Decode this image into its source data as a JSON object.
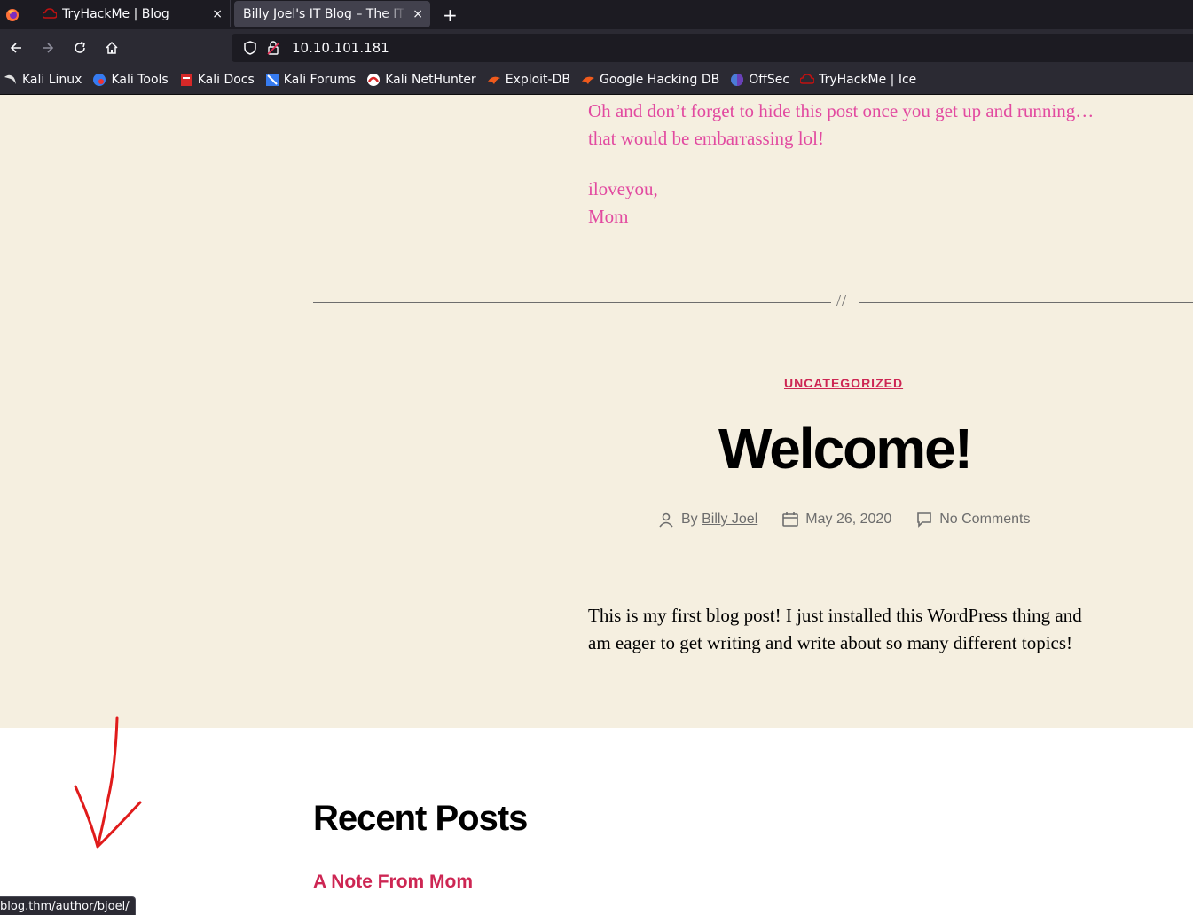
{
  "browser": {
    "tabs": [
      {
        "title": "TryHackMe | Blog",
        "close": "×"
      },
      {
        "title": "Billy Joel's IT Blog – The IT blog",
        "close": "×"
      }
    ],
    "new_tab": "+",
    "url": "10.10.101.181",
    "bookmarks": [
      {
        "label": "Kali Linux",
        "icon": "kali-dragon-icon"
      },
      {
        "label": "Kali Tools",
        "icon": "kali-tools-icon"
      },
      {
        "label": "Kali Docs",
        "icon": "kali-docs-icon"
      },
      {
        "label": "Kali Forums",
        "icon": "kali-forums-icon"
      },
      {
        "label": "Kali NetHunter",
        "icon": "nethunter-icon"
      },
      {
        "label": "Exploit-DB",
        "icon": "exploit-db-icon"
      },
      {
        "label": "Google Hacking DB",
        "icon": "ghdb-icon"
      },
      {
        "label": "OffSec",
        "icon": "offsec-icon"
      },
      {
        "label": "TryHackMe | Ice",
        "icon": "tryhackme-icon"
      }
    ],
    "status_url": "blog.thm/author/bjoel/"
  },
  "previous_post": {
    "paragraph": "Oh and don’t forget to hide this post once you get up and running… that would be embarrassing lol!",
    "signoff_1": "iloveyou,",
    "signoff_2": "Mom"
  },
  "separator_mark": "//",
  "post": {
    "category": "UNCATEGORIZED",
    "title": "Welcome!",
    "author_prefix": "By",
    "author": "Billy Joel",
    "date": "May 26, 2020",
    "comments": "No Comments",
    "body": "This is my first blog post! I just installed this WordPress thing and am eager to get writing and write about so many different topics!"
  },
  "recent_posts": {
    "heading": "Recent Posts",
    "items": [
      "A Note From Mom"
    ]
  },
  "colors": {
    "accent": "#cd2653",
    "pink_text": "#e24aa0",
    "background": "#f5efe0"
  }
}
